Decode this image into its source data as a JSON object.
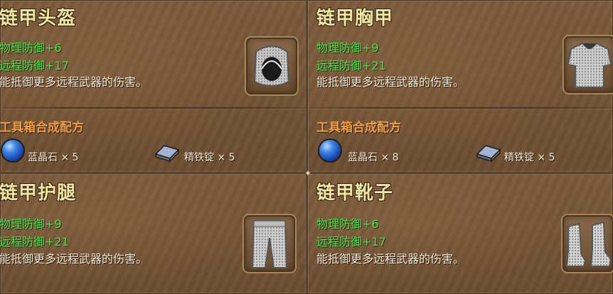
{
  "items": [
    {
      "title": "链甲头盔",
      "stats": [
        "物理防御+6",
        "远程防御+17"
      ],
      "desc": "能抵御更多远程武器的伤害。",
      "recipe_title": "工具箱合成配方",
      "materials": [
        {
          "icon": "blue-gem-icon",
          "label": "蓝晶石 × 5"
        },
        {
          "icon": "iron-ingot-icon",
          "label": "精铁锭 × 5"
        }
      ],
      "icon": "chainmail-helmet-icon"
    },
    {
      "title": "链甲胸甲",
      "stats": [
        "物理防御+9",
        "远程防御+21"
      ],
      "desc": "能抵御更多远程武器的伤害。",
      "recipe_title": "工具箱合成配方",
      "materials": [
        {
          "icon": "blue-gem-icon",
          "label": "蓝晶石 × 8"
        },
        {
          "icon": "iron-ingot-icon",
          "label": "精铁锭 × 5"
        }
      ],
      "icon": "chainmail-chestplate-icon"
    },
    {
      "title": "链甲护腿",
      "stats": [
        "物理防御+9",
        "远程防御+21"
      ],
      "desc": "能抵御更多远程武器的伤害。",
      "icon": "chainmail-leggings-icon"
    },
    {
      "title": "链甲靴子",
      "stats": [
        "物理防御+6",
        "远程防御+17"
      ],
      "desc": "能抵御更多远程武器的伤害。",
      "icon": "chainmail-boots-icon"
    }
  ],
  "colors": {
    "title": "#f2e7a0",
    "stat": "#4fe14a",
    "recipe": "#f0a040",
    "panel": "#7a5a3a"
  }
}
